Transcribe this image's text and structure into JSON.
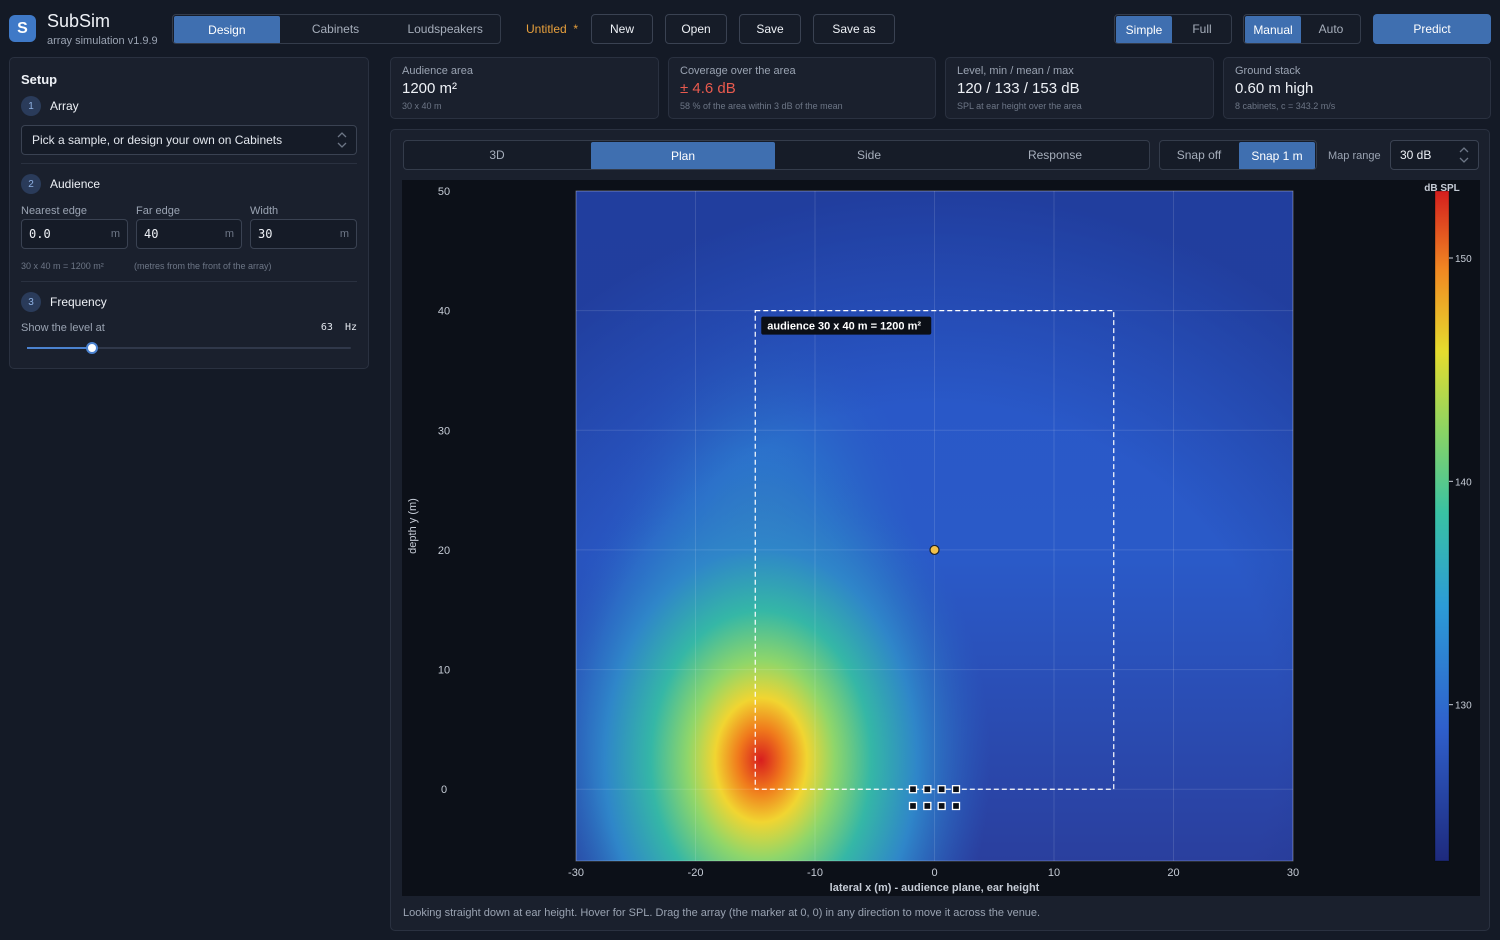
{
  "app": {
    "logo_letter": "S",
    "title": "SubSim",
    "subtitle": "array simulation  v1.9.9"
  },
  "nav_tabs": [
    {
      "label": "Design",
      "active": true
    },
    {
      "label": "Cabinets",
      "active": false
    },
    {
      "label": "Loudspeakers",
      "active": false
    }
  ],
  "document": {
    "name": "Untitled",
    "modified_marker": "*"
  },
  "file_buttons": {
    "new": "New",
    "open": "Open",
    "save": "Save",
    "save_as": "Save as"
  },
  "mode_toggle": [
    {
      "label": "Simple",
      "active": true
    },
    {
      "label": "Full",
      "active": false
    }
  ],
  "solve_toggle": [
    {
      "label": "Manual",
      "active": true
    },
    {
      "label": "Auto",
      "active": false
    }
  ],
  "predict_label": "Predict",
  "setup": {
    "title": "Setup",
    "array": {
      "num": "1",
      "label": "Array",
      "select_value": "Pick a sample, or design your own on Cabinets"
    },
    "audience": {
      "num": "2",
      "label": "Audience",
      "nearest": {
        "label": "Nearest edge",
        "value": "0.0",
        "unit": "m"
      },
      "far": {
        "label": "Far edge",
        "value": "40",
        "unit": "m"
      },
      "width": {
        "label": "Width",
        "value": "30",
        "unit": "m"
      },
      "area_note": "30 x 40 m  =  1200 m²",
      "hint": "(metres from the front of the array)"
    },
    "frequency": {
      "num": "3",
      "label": "Frequency",
      "show_label": "Show the level at",
      "value": "63",
      "unit": "Hz",
      "slider_fraction": 0.2
    }
  },
  "stats": {
    "audience_area": {
      "label": "Audience area",
      "value": "1200 m²",
      "sub": "30 x 40 m"
    },
    "coverage": {
      "label": "Coverage over the area",
      "value": "± 4.6 dB",
      "sub": "58 % of the area within 3 dB of the mean"
    },
    "level": {
      "label": "Level, min / mean / max",
      "value": "120 / 133 / 153 dB",
      "sub": "SPL at ear height over the area"
    },
    "ground_stack": {
      "label": "Ground stack",
      "value": "0.60 m high",
      "sub": "8 cabinets, c = 343.2 m/s"
    }
  },
  "view_tabs": [
    {
      "label": "3D",
      "active": false
    },
    {
      "label": "Plan",
      "active": true
    },
    {
      "label": "Side",
      "active": false
    },
    {
      "label": "Response",
      "active": false
    }
  ],
  "snap": [
    {
      "label": "Snap off",
      "active": false
    },
    {
      "label": "Snap 1 m",
      "active": true
    }
  ],
  "map_range": {
    "label": "Map range",
    "value": "30 dB"
  },
  "plot": {
    "x_label": "lateral  x (m)   -   audience plane, ear height",
    "y_label": "depth  y (m)",
    "x_range": [
      -30,
      30
    ],
    "y_range": [
      -6,
      50
    ],
    "x_ticks": [
      -30,
      -20,
      -10,
      0,
      10,
      20,
      30
    ],
    "y_ticks": [
      0,
      10,
      20,
      30,
      40,
      50
    ],
    "audience_box": {
      "x": [
        -15,
        15
      ],
      "y": [
        0,
        40
      ],
      "label": "audience 30 x 40 m  =  1200 m²"
    },
    "probe": {
      "x": 0,
      "y": 20
    },
    "array_markers": [
      {
        "x": -1.8,
        "y": 0
      },
      {
        "x": -0.6,
        "y": 0
      },
      {
        "x": 0.6,
        "y": 0
      },
      {
        "x": 1.8,
        "y": 0
      },
      {
        "x": -1.8,
        "y": -1.4
      },
      {
        "x": -0.6,
        "y": -1.4
      },
      {
        "x": 0.6,
        "y": -1.4
      },
      {
        "x": 1.8,
        "y": -1.4
      }
    ],
    "colorbar": {
      "title": "dB SPL",
      "ticks": [
        150,
        140,
        130
      ],
      "range": [
        123,
        153
      ]
    }
  },
  "caption": "Looking straight down at ear height. Hover for SPL. Drag the array (the marker at 0, 0) in any direction to move it across the venue.",
  "colors": {
    "accent": "#3f6fb0",
    "warning": "#e95a4e",
    "doc_name": "#e8a03c"
  }
}
